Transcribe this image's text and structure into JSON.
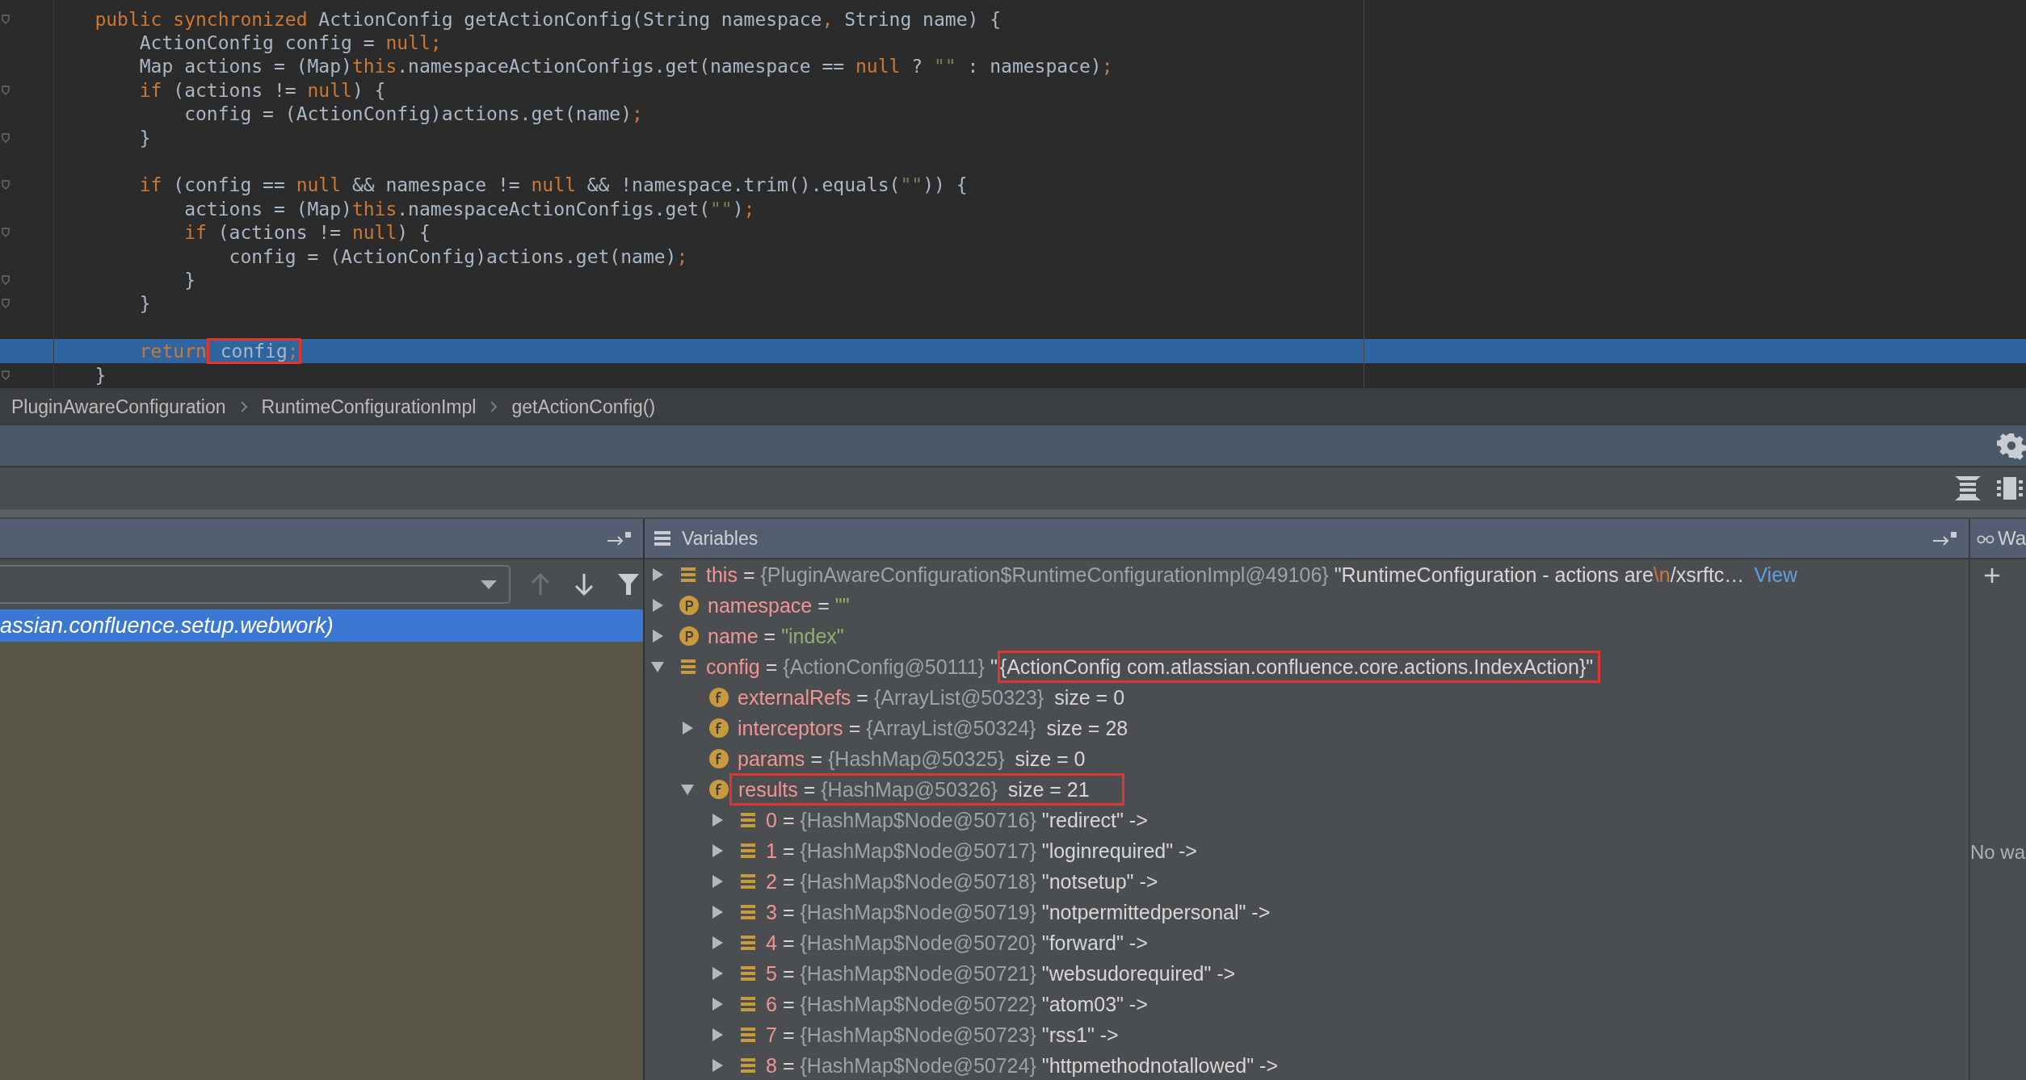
{
  "editor": {
    "lines": [
      {
        "fold": true,
        "current": false,
        "tokens": [
          {
            "kind": "keyword",
            "text": "    public synchronized "
          },
          {
            "kind": "plain",
            "text": "ActionConfig getActionConfig(String namespace"
          },
          {
            "kind": "keyword",
            "text": ","
          },
          {
            "kind": "plain",
            "text": " String name) {"
          }
        ]
      },
      {
        "fold": false,
        "current": false,
        "tokens": [
          {
            "kind": "plain",
            "text": "        ActionConfig config = "
          },
          {
            "kind": "keyword",
            "text": "null;"
          }
        ]
      },
      {
        "fold": false,
        "current": false,
        "tokens": [
          {
            "kind": "plain",
            "text": "        Map actions = (Map)"
          },
          {
            "kind": "keyword",
            "text": "this"
          },
          {
            "kind": "plain",
            "text": ".namespaceActionConfigs.get(namespace == "
          },
          {
            "kind": "keyword",
            "text": "null"
          },
          {
            "kind": "plain",
            "text": " ? "
          },
          {
            "kind": "string",
            "text": "\"\""
          },
          {
            "kind": "plain",
            "text": " : namespace)"
          },
          {
            "kind": "keyword",
            "text": ";"
          }
        ]
      },
      {
        "fold": true,
        "current": false,
        "tokens": [
          {
            "kind": "keyword",
            "text": "        if"
          },
          {
            "kind": "plain",
            "text": " (actions != "
          },
          {
            "kind": "keyword",
            "text": "null"
          },
          {
            "kind": "plain",
            "text": ") {"
          }
        ]
      },
      {
        "fold": false,
        "current": false,
        "tokens": [
          {
            "kind": "plain",
            "text": "            config = (ActionConfig)actions.get(name)"
          },
          {
            "kind": "keyword",
            "text": ";"
          }
        ]
      },
      {
        "fold": true,
        "current": false,
        "tokens": [
          {
            "kind": "plain",
            "text": "        }"
          }
        ]
      },
      {
        "fold": false,
        "current": false
      },
      {
        "fold": true,
        "current": false,
        "tokens": [
          {
            "kind": "keyword",
            "text": "        if"
          },
          {
            "kind": "plain",
            "text": " (config == "
          },
          {
            "kind": "keyword",
            "text": "null"
          },
          {
            "kind": "plain",
            "text": " && namespace != "
          },
          {
            "kind": "keyword",
            "text": "null"
          },
          {
            "kind": "plain",
            "text": " && !namespace.trim().equals("
          },
          {
            "kind": "string",
            "text": "\"\""
          },
          {
            "kind": "plain",
            "text": ")) {"
          }
        ]
      },
      {
        "fold": false,
        "current": false,
        "tokens": [
          {
            "kind": "plain",
            "text": "            actions = (Map)"
          },
          {
            "kind": "keyword",
            "text": "this"
          },
          {
            "kind": "plain",
            "text": ".namespaceActionConfigs.get("
          },
          {
            "kind": "string",
            "text": "\"\""
          },
          {
            "kind": "plain",
            "text": ")"
          },
          {
            "kind": "keyword",
            "text": ";"
          }
        ]
      },
      {
        "fold": true,
        "current": false,
        "tokens": [
          {
            "kind": "keyword",
            "text": "            if"
          },
          {
            "kind": "plain",
            "text": " (actions != "
          },
          {
            "kind": "keyword",
            "text": "null"
          },
          {
            "kind": "plain",
            "text": ") {"
          }
        ]
      },
      {
        "fold": false,
        "current": false,
        "tokens": [
          {
            "kind": "plain",
            "text": "                config = (ActionConfig)actions.get(name)"
          },
          {
            "kind": "keyword",
            "text": ";"
          }
        ]
      },
      {
        "fold": true,
        "current": false,
        "tokens": [
          {
            "kind": "plain",
            "text": "            }"
          }
        ]
      },
      {
        "fold": true,
        "current": false,
        "tokens": [
          {
            "kind": "plain",
            "text": "        }"
          }
        ]
      },
      {
        "fold": false,
        "current": false
      },
      {
        "fold": false,
        "current": true,
        "tokens": [
          {
            "kind": "keyword",
            "text": "        return"
          },
          {
            "kind": "boxed",
            "parts": [
              {
                "kind": "plain",
                "text": " config"
              },
              {
                "kind": "keyword",
                "text": ";"
              }
            ]
          }
        ]
      },
      {
        "fold": true,
        "current": false,
        "tokens": [
          {
            "kind": "plain",
            "text": "    }"
          }
        ]
      }
    ]
  },
  "breadcrumbs": [
    "PluginAwareConfiguration",
    "RuntimeConfigurationImpl",
    "getActionConfig()"
  ],
  "frames": {
    "buttons": [
      {
        "kind": "up",
        "disabled": true
      },
      {
        "kind": "down",
        "disabled": false
      },
      {
        "kind": "filter",
        "disabled": false
      }
    ],
    "items": [
      {
        "text": "assian.confluence.setup.webwork)",
        "selected": true
      }
    ]
  },
  "variables": {
    "title": "Variables",
    "items": [
      {
        "kind": "list",
        "name": "this",
        "assign": "=",
        "type": "{PluginAwareConfiguration$RuntimeConfigurationImpl@49106}",
        "value_parts": [
          {
            "kind": "text",
            "text": "\"RuntimeConfiguration - actions are"
          },
          {
            "kind": "escape",
            "text": "\\n"
          },
          {
            "kind": "text",
            "text": "/xsrftc…"
          }
        ],
        "link": "View",
        "expanded": false
      },
      {
        "kind": "param",
        "name": "namespace",
        "assign": "=",
        "value_parts": [
          {
            "kind": "string",
            "text": "\"\""
          }
        ],
        "expanded": false
      },
      {
        "kind": "param",
        "name": "name",
        "assign": "=",
        "value_parts": [
          {
            "kind": "string",
            "text": "\"index\""
          }
        ],
        "expanded": false
      },
      {
        "kind": "list",
        "name": "config",
        "assign": "=",
        "type": "{ActionConfig@50111}",
        "value_parts": [
          {
            "kind": "text",
            "text": "\""
          },
          {
            "kind": "boxed",
            "text": "{ActionConfig com.atlassian.confluence.core.actions.IndexAction}\""
          }
        ],
        "expanded": true,
        "children": [
          {
            "kind": "field",
            "name": "externalRefs",
            "assign": "=",
            "type": "{ArrayList@50323}",
            "size": "size = 0"
          },
          {
            "kind": "field",
            "name": "interceptors",
            "assign": "=",
            "type": "{ArrayList@50324}",
            "size": "size = 28",
            "expanded": false
          },
          {
            "kind": "field",
            "name": "params",
            "assign": "=",
            "type": "{HashMap@50325}",
            "size": "size = 0"
          },
          {
            "kind": "field",
            "name": "results",
            "assign": "=",
            "type": "{HashMap@50326}",
            "size": "size = 21",
            "boxed": true,
            "expanded": true,
            "children": [
              {
                "kind": "list",
                "name": "0",
                "assign": "=",
                "type": "{HashMap$Node@50716}",
                "value_parts": [
                  {
                    "kind": "text",
                    "text": "\"redirect\" ->"
                  }
                ],
                "expanded": false
              },
              {
                "kind": "list",
                "name": "1",
                "assign": "=",
                "type": "{HashMap$Node@50717}",
                "value_parts": [
                  {
                    "kind": "text",
                    "text": "\"loginrequired\" ->"
                  }
                ],
                "expanded": false
              },
              {
                "kind": "list",
                "name": "2",
                "assign": "=",
                "type": "{HashMap$Node@50718}",
                "value_parts": [
                  {
                    "kind": "text",
                    "text": "\"notsetup\" ->"
                  }
                ],
                "expanded": false
              },
              {
                "kind": "list",
                "name": "3",
                "assign": "=",
                "type": "{HashMap$Node@50719}",
                "value_parts": [
                  {
                    "kind": "text",
                    "text": "\"notpermittedpersonal\" ->"
                  }
                ],
                "expanded": false
              },
              {
                "kind": "list",
                "name": "4",
                "assign": "=",
                "type": "{HashMap$Node@50720}",
                "value_parts": [
                  {
                    "kind": "text",
                    "text": "\"forward\" ->"
                  }
                ],
                "expanded": false
              },
              {
                "kind": "list",
                "name": "5",
                "assign": "=",
                "type": "{HashMap$Node@50721}",
                "value_parts": [
                  {
                    "kind": "text",
                    "text": "\"websudorequired\" ->"
                  }
                ],
                "expanded": false
              },
              {
                "kind": "list",
                "name": "6",
                "assign": "=",
                "type": "{HashMap$Node@50722}",
                "value_parts": [
                  {
                    "kind": "text",
                    "text": "\"atom03\" ->"
                  }
                ],
                "expanded": false
              },
              {
                "kind": "list",
                "name": "7",
                "assign": "=",
                "type": "{HashMap$Node@50723}",
                "value_parts": [
                  {
                    "kind": "text",
                    "text": "\"rss1\" ->"
                  }
                ],
                "expanded": false
              },
              {
                "kind": "list",
                "name": "8",
                "assign": "=",
                "type": "{HashMap$Node@50724}",
                "value_parts": [
                  {
                    "kind": "text",
                    "text": "\"httpmethodnotallowed\" ->"
                  }
                ],
                "expanded": false
              }
            ]
          }
        ]
      }
    ]
  },
  "watches": {
    "title": "Wa",
    "empty_text": "No wa"
  }
}
